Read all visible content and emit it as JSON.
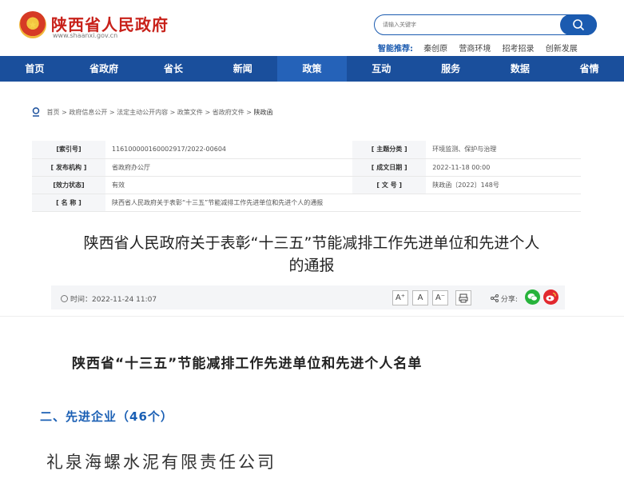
{
  "header": {
    "site_title": "陕西省人民政府",
    "site_url": "www.shaanxi.gov.cn",
    "search_placeholder": "请输入关键字",
    "recommend_label": "智能推荐:",
    "recommend_links": [
      "秦创原",
      "营商环境",
      "招考招录",
      "创新发展"
    ]
  },
  "nav": {
    "items": [
      "首页",
      "省政府",
      "省长",
      "新闻",
      "政策",
      "互动",
      "服务",
      "数据",
      "省情"
    ],
    "active_index": 4
  },
  "breadcrumb": {
    "path": "首页 > 政府信息公开 > 法定主动公开内容 > 政策文件 > 省政府文件 > ",
    "current": "陕政函"
  },
  "info": {
    "index_label": "[索引号]",
    "index_value": "116100000160002917/2022-00604",
    "topic_label": "[ 主题分类 ]",
    "topic_value": "环境监测、保护与治理",
    "org_label": "[ 发布机构 ]",
    "org_value": "省政府办公厅",
    "date_label": "[ 成文日期 ]",
    "date_value": "2022-11-18 00:00",
    "status_label": "[效力状态]",
    "status_value": "有效",
    "docno_label": "[ 文 号 ]",
    "docno_value": "陕政函〔2022〕148号",
    "name_label": "[ 名 称 ]",
    "name_value": "陕西省人民政府关于表彰“十三五”节能减排工作先进单位和先进个人的通报"
  },
  "doc": {
    "title_line1": "陕西省人民政府关于表彰“十三五”节能减排工作先进单位和先进个人",
    "title_line2": "的通报",
    "time": "时间：2022-11-24 11:07",
    "font_large": "A⁺",
    "font_medium": "A",
    "font_small": "A⁻",
    "share_label": "分享:"
  },
  "body": {
    "list_title": "陕西省“十三五”节能减排工作先进单位和先进个人名单",
    "section_title": "二、先进企业（46个）",
    "company": "礼泉海螺水泥有限责任公司"
  }
}
